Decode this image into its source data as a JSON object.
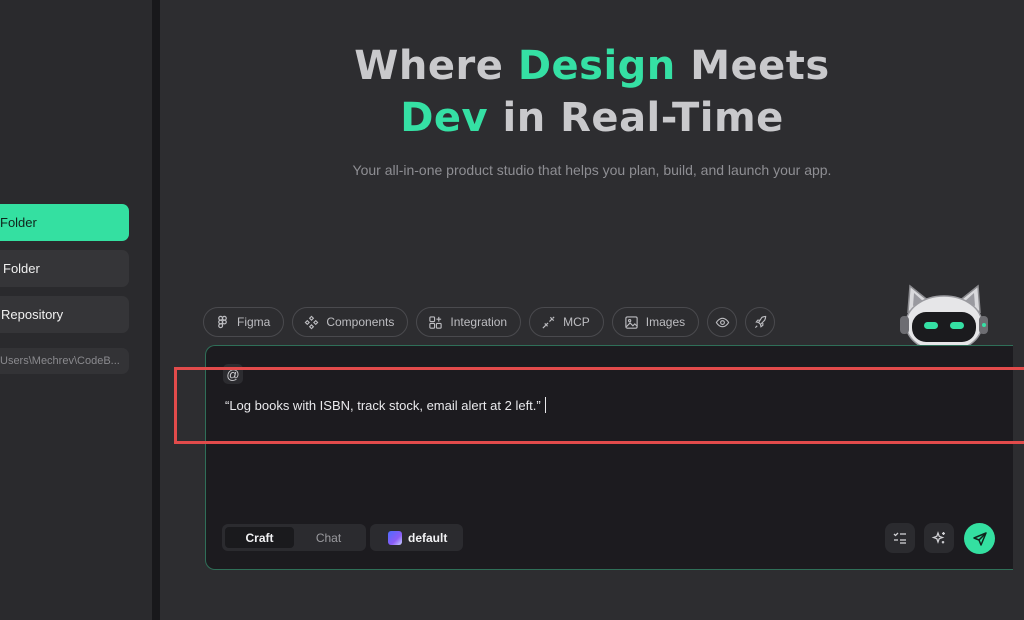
{
  "sidebar": {
    "new_folder_label": "Folder",
    "open_folder_label": "Folder",
    "clone_repo_label": "Repository",
    "path_label": "Users\\Mechrev\\CodeB..."
  },
  "hero": {
    "title_part1": "Where ",
    "title_accent1": "Design",
    "title_part2": " Meets",
    "title_accent2": "Dev",
    "title_part3": " in Real-Time",
    "subtitle": "Your all-in-one product studio that helps you plan, build, and launch your app."
  },
  "chips": [
    {
      "label": "Figma",
      "icon": "figma-icon"
    },
    {
      "label": "Components",
      "icon": "components-icon"
    },
    {
      "label": "Integration",
      "icon": "integration-icon"
    },
    {
      "label": "MCP",
      "icon": "mcp-icon"
    },
    {
      "label": "Images",
      "icon": "image-icon"
    }
  ],
  "composer": {
    "at_label": "@",
    "prompt_text": "“Log books with ISBN, track stock, email alert at 2 left.”",
    "modes": [
      "Craft",
      "Chat"
    ],
    "active_mode": "Craft",
    "model_label": "default"
  },
  "colors": {
    "accent": "#34e0a1",
    "highlight": "#e24b4b",
    "background": "#2d2d30"
  }
}
